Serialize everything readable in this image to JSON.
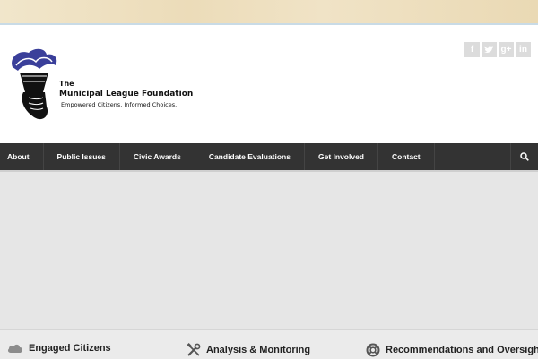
{
  "header": {
    "logo": {
      "line1": "The",
      "line2": "Municipal League Foundation",
      "tagline": "Empowered Citizens. Informed Choices."
    },
    "social": [
      {
        "name": "facebook-icon",
        "glyph": "f"
      },
      {
        "name": "twitter-icon",
        "glyph": "t"
      },
      {
        "name": "google-plus-icon",
        "glyph": "g+"
      },
      {
        "name": "linkedin-icon",
        "glyph": "in"
      }
    ]
  },
  "nav": {
    "items": [
      "About",
      "Public Issues",
      "Civic Awards",
      "Candidate Evaluations",
      "Get Involved",
      "Contact"
    ],
    "search_icon": "search-icon"
  },
  "features": [
    {
      "title": "Engaged Citizens",
      "icon": "cloud-icon"
    },
    {
      "title": "Analysis & Monitoring",
      "icon": "tools-icon"
    },
    {
      "title": "Recommendations and Oversight",
      "icon": "lifebuoy-icon"
    }
  ],
  "colors": {
    "nav_bg": "#333333",
    "logo_blue": "#3a3f9a",
    "social_bg": "#dcdcdc"
  }
}
